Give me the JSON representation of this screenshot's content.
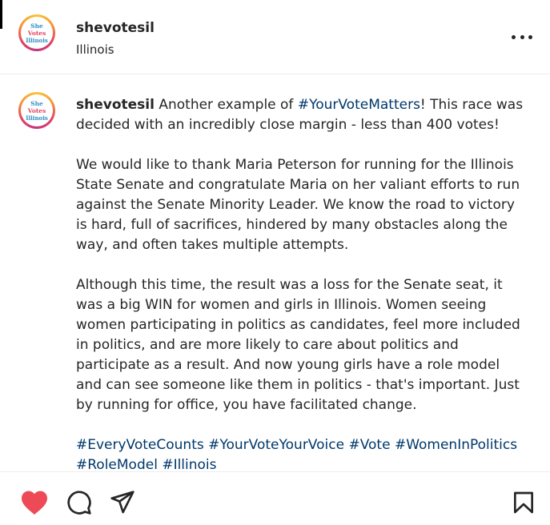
{
  "post": {
    "username": "shevotesil",
    "location": "Illinois",
    "avatar_text": [
      "She",
      "Votes",
      "Illinois"
    ]
  },
  "caption": {
    "username": "shevotesil",
    "p1_a": " Another example of ",
    "p1_tag": "#YourVoteMatters",
    "p1_b": "! This race was decided with an incredibly close margin - less than 400 votes!",
    "p2": "We would like to thank Maria Peterson for running for the Illinois State Senate and congratulate Maria on her valiant efforts to run against the Senate Minority Leader. We know the road to victory is hard, full of sacrifices, hindered by many obstacles along the way, and often takes multiple attempts.",
    "p3": "Although this time, the result was a loss for the Senate seat, it was a big WIN for women and girls in Illinois. Women seeing women participating in politics as candidates, feel more included in politics, and are more likely to care about politics and participate as a result. And now young girls have a role model and can see someone like them in politics - that's important. Just by running for office, you have facilitated change.",
    "hashtags": [
      "#EveryVoteCounts",
      "#YourVoteYourVoice",
      "#Vote",
      "#WomenInPolitics",
      "#RoleModel",
      "#Illinois"
    ]
  },
  "actions": {
    "like_icon": "heart-filled-icon",
    "comment_icon": "comment-icon",
    "share_icon": "share-icon",
    "save_icon": "bookmark-icon"
  },
  "colors": {
    "like": "#ed4956",
    "hashtag": "#00376b",
    "text": "#262626"
  }
}
